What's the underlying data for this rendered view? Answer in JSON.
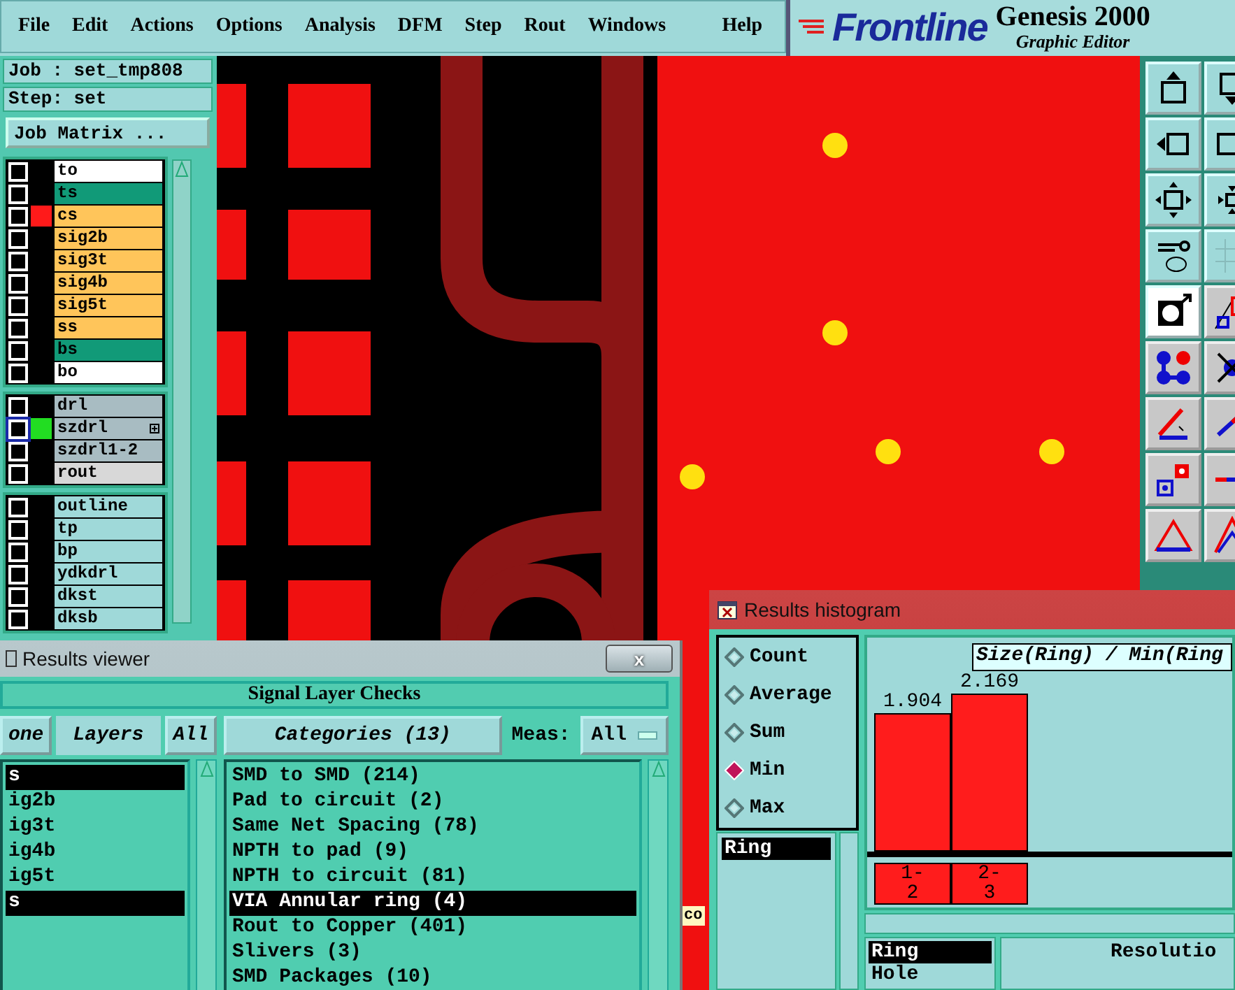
{
  "menu": [
    {
      "label": "File"
    },
    {
      "label": "Edit"
    },
    {
      "label": "Actions"
    },
    {
      "label": "Options"
    },
    {
      "label": "Analysis"
    },
    {
      "label": "DFM"
    },
    {
      "label": "Step"
    },
    {
      "label": "Rout"
    },
    {
      "label": "Windows"
    },
    {
      "label": "Help"
    }
  ],
  "logo": {
    "brand": "Frontline",
    "product": "Genesis 2000",
    "subtitle": "Graphic Editor"
  },
  "job_panel": {
    "job": "Job : set_tmp808",
    "step": "Step: set",
    "matrix_button": "Job Matrix ..."
  },
  "layer_groups": [
    {
      "layers": [
        {
          "name": "to",
          "kind": "silk",
          "checked": false,
          "selected": false
        },
        {
          "name": "ts",
          "kind": "mask",
          "checked": false,
          "selected": false
        },
        {
          "name": "cs",
          "kind": "signal",
          "checked": false,
          "selected": false,
          "color": "#ff1a1a"
        },
        {
          "name": "sig2b",
          "kind": "signal",
          "checked": false,
          "selected": false
        },
        {
          "name": "sig3t",
          "kind": "signal",
          "checked": false,
          "selected": false
        },
        {
          "name": "sig4b",
          "kind": "signal",
          "checked": false,
          "selected": false
        },
        {
          "name": "sig5t",
          "kind": "signal",
          "checked": false,
          "selected": false
        },
        {
          "name": "ss",
          "kind": "signal",
          "checked": false,
          "selected": false
        },
        {
          "name": "bs",
          "kind": "mask",
          "checked": false,
          "selected": false
        },
        {
          "name": "bo",
          "kind": "silk",
          "checked": false,
          "selected": false
        }
      ]
    },
    {
      "layers": [
        {
          "name": "drl",
          "kind": "drill",
          "checked": false,
          "selected": false
        },
        {
          "name": "szdrl",
          "kind": "drill",
          "checked": false,
          "selected": true,
          "color": "#22dd22"
        },
        {
          "name": "szdrl1-2",
          "kind": "drill",
          "checked": false,
          "selected": false
        },
        {
          "name": "rout",
          "kind": "rout",
          "checked": false,
          "selected": false
        }
      ]
    },
    {
      "layers": [
        {
          "name": "outline",
          "kind": "document",
          "checked": false,
          "selected": false
        },
        {
          "name": "tp",
          "kind": "document",
          "checked": false,
          "selected": false
        },
        {
          "name": "bp",
          "kind": "document",
          "checked": false,
          "selected": false
        },
        {
          "name": "ydkdrl",
          "kind": "document",
          "checked": false,
          "selected": false
        },
        {
          "name": "dkst",
          "kind": "document",
          "checked": false,
          "selected": false
        },
        {
          "name": "dksb",
          "kind": "document",
          "checked": false,
          "selected": false
        }
      ]
    }
  ],
  "background_label": "co",
  "results_viewer": {
    "title": "Results viewer",
    "close": "x",
    "heading": "Signal Layer Checks",
    "none_button": "one",
    "layers_header": "Layers",
    "all_button": "All",
    "layers": [
      {
        "name": "s",
        "selected": true
      },
      {
        "name": "ig2b",
        "selected": false
      },
      {
        "name": "ig3t",
        "selected": false
      },
      {
        "name": "ig4b",
        "selected": false
      },
      {
        "name": "ig5t",
        "selected": false
      },
      {
        "name": "s",
        "selected": true
      }
    ],
    "categories_header": "Categories (13)",
    "meas_label": "Meas:",
    "meas_value": "All",
    "categories": [
      {
        "label": "SMD to SMD (214)",
        "selected": false
      },
      {
        "label": "Pad to circuit (2)",
        "selected": false
      },
      {
        "label": "Same Net Spacing (78)",
        "selected": false
      },
      {
        "label": "NPTH to pad (9)",
        "selected": false
      },
      {
        "label": "NPTH to circuit (81)",
        "selected": false
      },
      {
        "label": "VIA Annular ring (4)",
        "selected": true
      },
      {
        "label": "Rout to Copper (401)",
        "selected": false
      },
      {
        "label": "Slivers (3)",
        "selected": false
      },
      {
        "label": "SMD Packages (10)",
        "selected": false
      }
    ]
  },
  "histogram": {
    "title": "Results histogram",
    "modes": [
      {
        "label": "Count",
        "selected": false
      },
      {
        "label": "Average",
        "selected": false
      },
      {
        "label": "Sum",
        "selected": false
      },
      {
        "label": "Min",
        "selected": true
      },
      {
        "label": "Max",
        "selected": false
      }
    ],
    "measures": [
      {
        "label": "Ring",
        "selected": true
      }
    ],
    "chart_data": {
      "type": "bar",
      "title": "Size(Ring) / Min(Ring",
      "categories": [
        "1-2",
        "2-3"
      ],
      "values": [
        1.904,
        2.169
      ],
      "data_labels": true
    },
    "bottom_list": [
      {
        "label": "Ring",
        "selected": true
      },
      {
        "label": "Hole",
        "selected": false
      }
    ],
    "resolution_label": "Resolutio"
  }
}
